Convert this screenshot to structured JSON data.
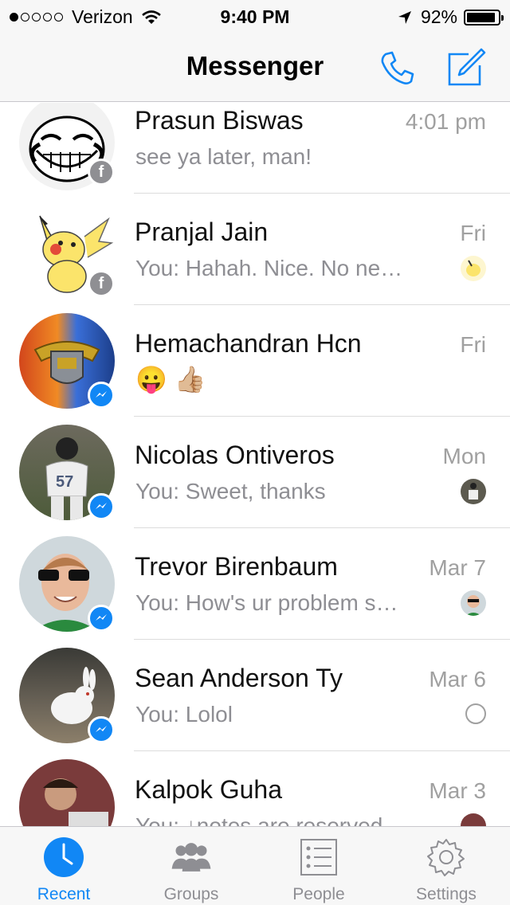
{
  "status_bar": {
    "carrier": "Verizon",
    "time": "9:40 PM",
    "battery_percent": "92%",
    "battery_level": 0.92,
    "signal_bars_filled": 1,
    "signal_bars_total": 5
  },
  "nav": {
    "title": "Messenger",
    "call_icon": "phone-icon",
    "compose_icon": "compose-icon"
  },
  "colors": {
    "accent": "#1187f5",
    "secondary_text": "#8e8e93",
    "separator": "#dcdcdc"
  },
  "conversations": [
    {
      "name": "Prasun Biswas",
      "time": "4:01 pm",
      "preview": "see ya later, man!",
      "badge": "facebook",
      "seen": "none"
    },
    {
      "name": "Pranjal Jain",
      "time": "Fri",
      "preview": "You: Hahah. Nice.  No ne…",
      "badge": "facebook",
      "seen": "avatar"
    },
    {
      "name": "Hemachandran Hcn",
      "time": "Fri",
      "preview": "😛 👍🏼",
      "badge": "messenger",
      "seen": "none"
    },
    {
      "name": "Nicolas Ontiveros",
      "time": "Mon",
      "preview": "You: Sweet, thanks",
      "badge": "messenger",
      "seen": "avatar"
    },
    {
      "name": "Trevor Birenbaum",
      "time": "Mar 7",
      "preview": "You: How's ur problem s…",
      "badge": "messenger",
      "seen": "avatar"
    },
    {
      "name": "Sean Anderson Ty",
      "time": "Mar 6",
      "preview": "You: Lolol",
      "badge": "messenger",
      "seen": "sent"
    },
    {
      "name": "Kalpok Guha",
      "time": "Mar 3",
      "preview": "You: ↓notes are reserved…",
      "badge": "none",
      "seen": "avatar"
    }
  ],
  "tabs": [
    {
      "label": "Recent",
      "icon": "clock-icon",
      "active": true
    },
    {
      "label": "Groups",
      "icon": "groups-icon",
      "active": false
    },
    {
      "label": "People",
      "icon": "people-list-icon",
      "active": false
    },
    {
      "label": "Settings",
      "icon": "gear-icon",
      "active": false
    }
  ]
}
